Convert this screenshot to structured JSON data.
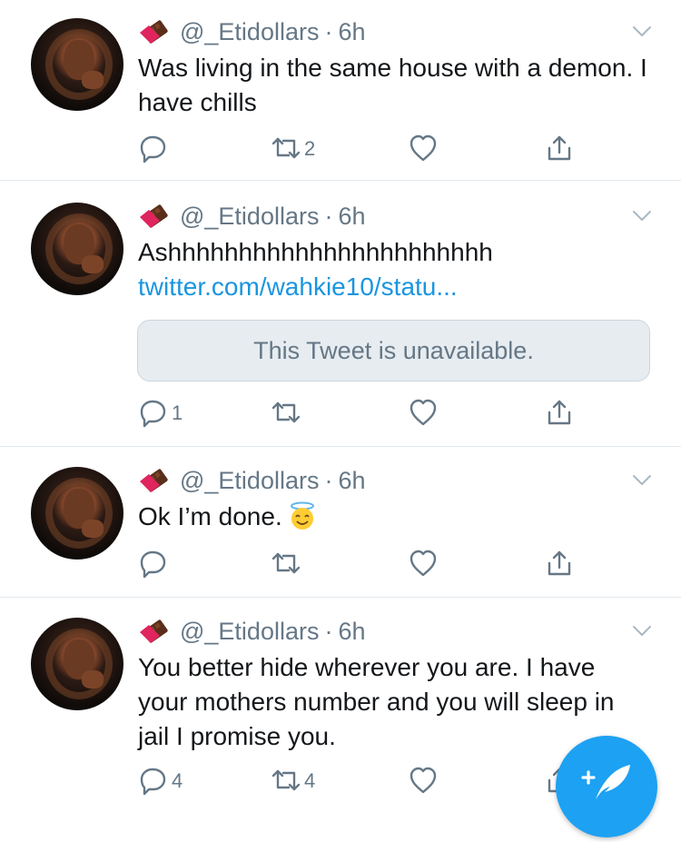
{
  "tweets": [
    {
      "handle": "@_Etidollars",
      "time": "6h",
      "text": "Was living in the same house with a demon. I have chills",
      "reply_count": "",
      "retweet_count": "2"
    },
    {
      "handle": "@_Etidollars",
      "time": "6h",
      "text": "Ashhhhhhhhhhhhhhhhhhhhhhh",
      "link": "twitter.com/wahkie10/statu...",
      "quote": "This Tweet is unavailable.",
      "reply_count": "1",
      "retweet_count": ""
    },
    {
      "handle": "@_Etidollars",
      "time": "6h",
      "text": "Ok I’m done.",
      "emoji": "smiling-face-with-halo",
      "reply_count": "",
      "retweet_count": ""
    },
    {
      "handle": "@_Etidollars",
      "time": "6h",
      "text": "You better hide wherever you are. I have your mothers number and you will sleep in jail I promise you.",
      "reply_count": "4",
      "retweet_count": "4"
    }
  ],
  "separator": "·",
  "colors": {
    "text": "#14171a",
    "muted": "#657786",
    "link": "#1b95e0",
    "fab": "#1da1f2",
    "border": "#e1e8ed"
  },
  "icons": [
    "chocolate-bar-icon",
    "chevron-down-icon",
    "reply-icon",
    "retweet-icon",
    "like-icon",
    "share-icon",
    "compose-tweet-icon"
  ]
}
